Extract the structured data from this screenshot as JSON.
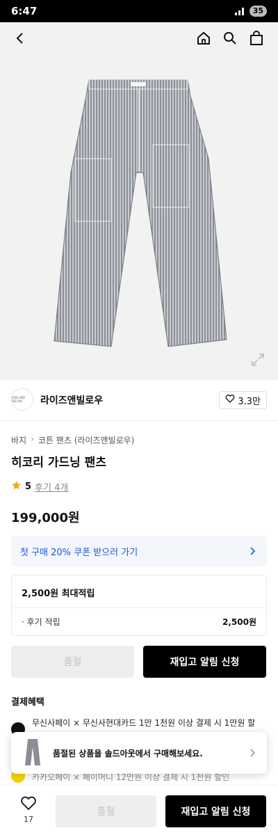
{
  "status_bar": {
    "time": "6:47",
    "battery": "35"
  },
  "header": {
    "icons": [
      "back-icon",
      "home-icon",
      "search-icon",
      "shopping-bag-icon"
    ]
  },
  "product_image": {
    "icon": "expand-icon"
  },
  "brand": {
    "logo_text": "RISE AND BELOW",
    "name": "라이즈앤빌로우",
    "likes": "3.3만"
  },
  "breadcrumb": [
    "바지",
    "코튼 팬츠 (라이즈앤빌로우)"
  ],
  "product": {
    "title": "히코리 가드닝 팬츠",
    "rating": "5",
    "review_link": "후기 4개",
    "price": "199,000원"
  },
  "coupon": {
    "text": "첫 구매 20% 쿠폰 받으러 가기"
  },
  "points": {
    "max": "2,500원 최대적립",
    "review_label": "· 후기 적립",
    "review_value": "2,500원"
  },
  "buttons": {
    "soldout": "품절",
    "restock": "재입고 알림 신청"
  },
  "benefits": {
    "title": "결제혜택",
    "items": [
      {
        "text": "무신사페이 × 무신사현대카드 1만 1천원 이상 결제 시 1만원 할"
      },
      {
        "text": "카카오페이 × 페이머니 12만원 이상 결제 시 1천원 할인"
      }
    ]
  },
  "toast": {
    "text": "품절된 상품을 솔드아웃에서 구매해보세요."
  },
  "bottom_bar": {
    "like_count": "17",
    "soldout": "품절",
    "restock": "재입고 알림 신청"
  },
  "colors": {
    "accent_blue": "#1f55d6",
    "star": "#f5a623",
    "primary_button": "#000000"
  }
}
